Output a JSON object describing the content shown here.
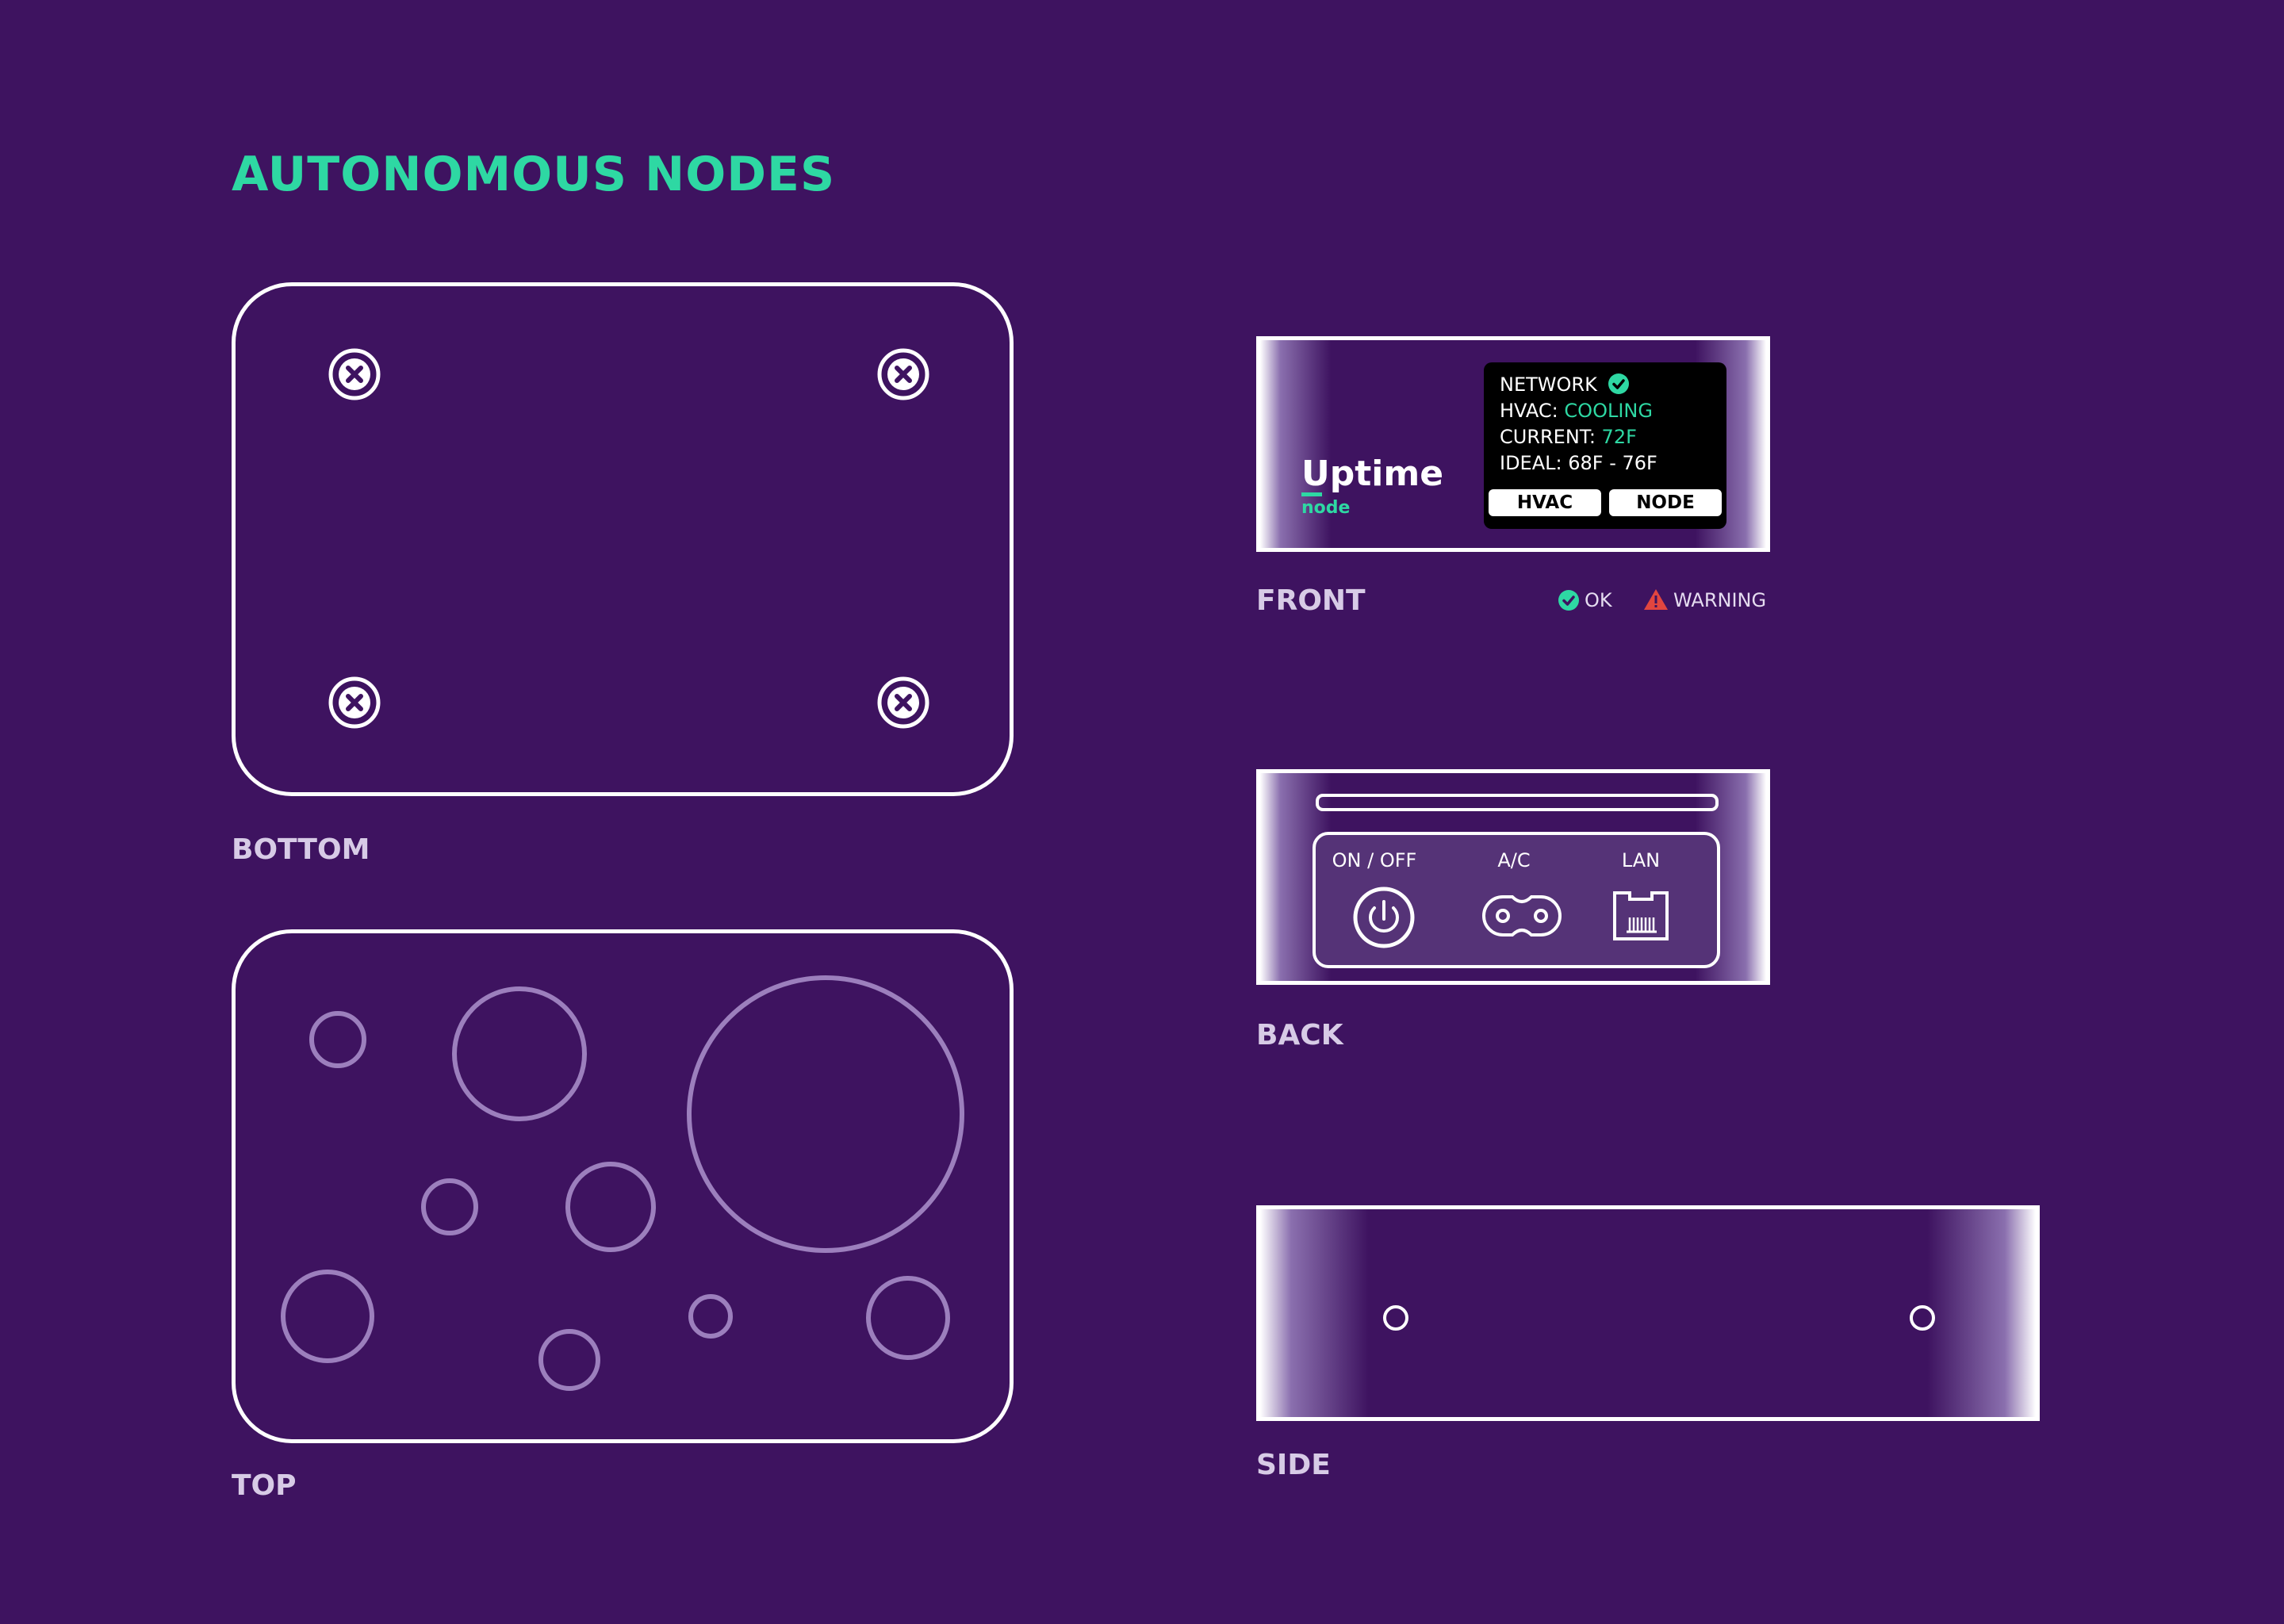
{
  "title": "AUTONOMOUS NODES",
  "views": {
    "bottom": "BOTTOM",
    "top": "TOP",
    "front": "FRONT",
    "back": "BACK",
    "side": "SIDE"
  },
  "brand": {
    "name": "Uptime",
    "sub": "node"
  },
  "screen": {
    "network_label": "NETWORK",
    "hvac_label": "HVAC:",
    "hvac_value": "COOLING",
    "current_label": "CURRENT:",
    "current_value": "72F",
    "ideal_label": "IDEAL:",
    "ideal_value": "68F - 76F",
    "btn_hvac": "HVAC",
    "btn_node": "NODE"
  },
  "legend": {
    "ok": "OK",
    "warning": "WARNING"
  },
  "ports": {
    "power": "ON / OFF",
    "ac": "A/C",
    "lan": "LAN"
  },
  "colors": {
    "background": "#3e1360",
    "accent": "#2ed8a3",
    "warning": "#e2463f",
    "outline": "#ffffff",
    "hole": "#9c7fbd"
  },
  "icons": {
    "screw": "screw-icon",
    "check": "check-circle-icon",
    "warning": "warning-triangle-icon",
    "power": "power-icon",
    "ac": "ac-plug-icon",
    "lan": "ethernet-port-icon"
  }
}
